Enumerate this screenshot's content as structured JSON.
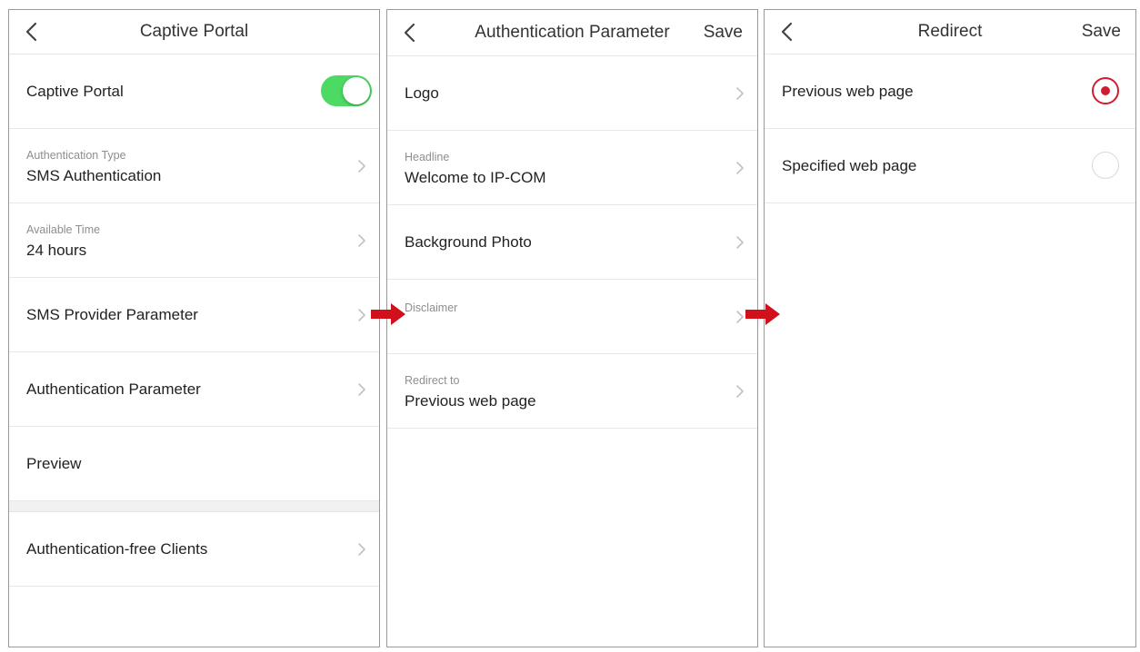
{
  "panel1": {
    "title": "Captive Portal",
    "toggle_label": "Captive Portal",
    "toggle_on": true,
    "auth_type_label": "Authentication Type",
    "auth_type_value": "SMS Authentication",
    "available_time_label": "Available Time",
    "available_time_value": "24 hours",
    "sms_provider": "SMS Provider Parameter",
    "auth_param": "Authentication Parameter",
    "preview": "Preview",
    "auth_free": "Authentication-free Clients"
  },
  "panel2": {
    "title": "Authentication Parameter",
    "save": "Save",
    "logo": "Logo",
    "headline_label": "Headline",
    "headline_value": "Welcome to IP-COM",
    "background": "Background Photo",
    "disclaimer_label": "Disclaimer",
    "redirect_label": "Redirect to",
    "redirect_value": "Previous web page"
  },
  "panel3": {
    "title": "Redirect",
    "save": "Save",
    "options": [
      {
        "label": "Previous web page",
        "selected": true
      },
      {
        "label": "Specified web page",
        "selected": false
      }
    ]
  },
  "colors": {
    "toggle_on": "#4cd964",
    "radio_selected": "#cf1f2e",
    "arrow": "#d0111b",
    "preview_link": "#6ea6b8"
  },
  "icons": [
    "back-chevron-icon",
    "chevron-right-icon",
    "flow-arrow-icon"
  ]
}
